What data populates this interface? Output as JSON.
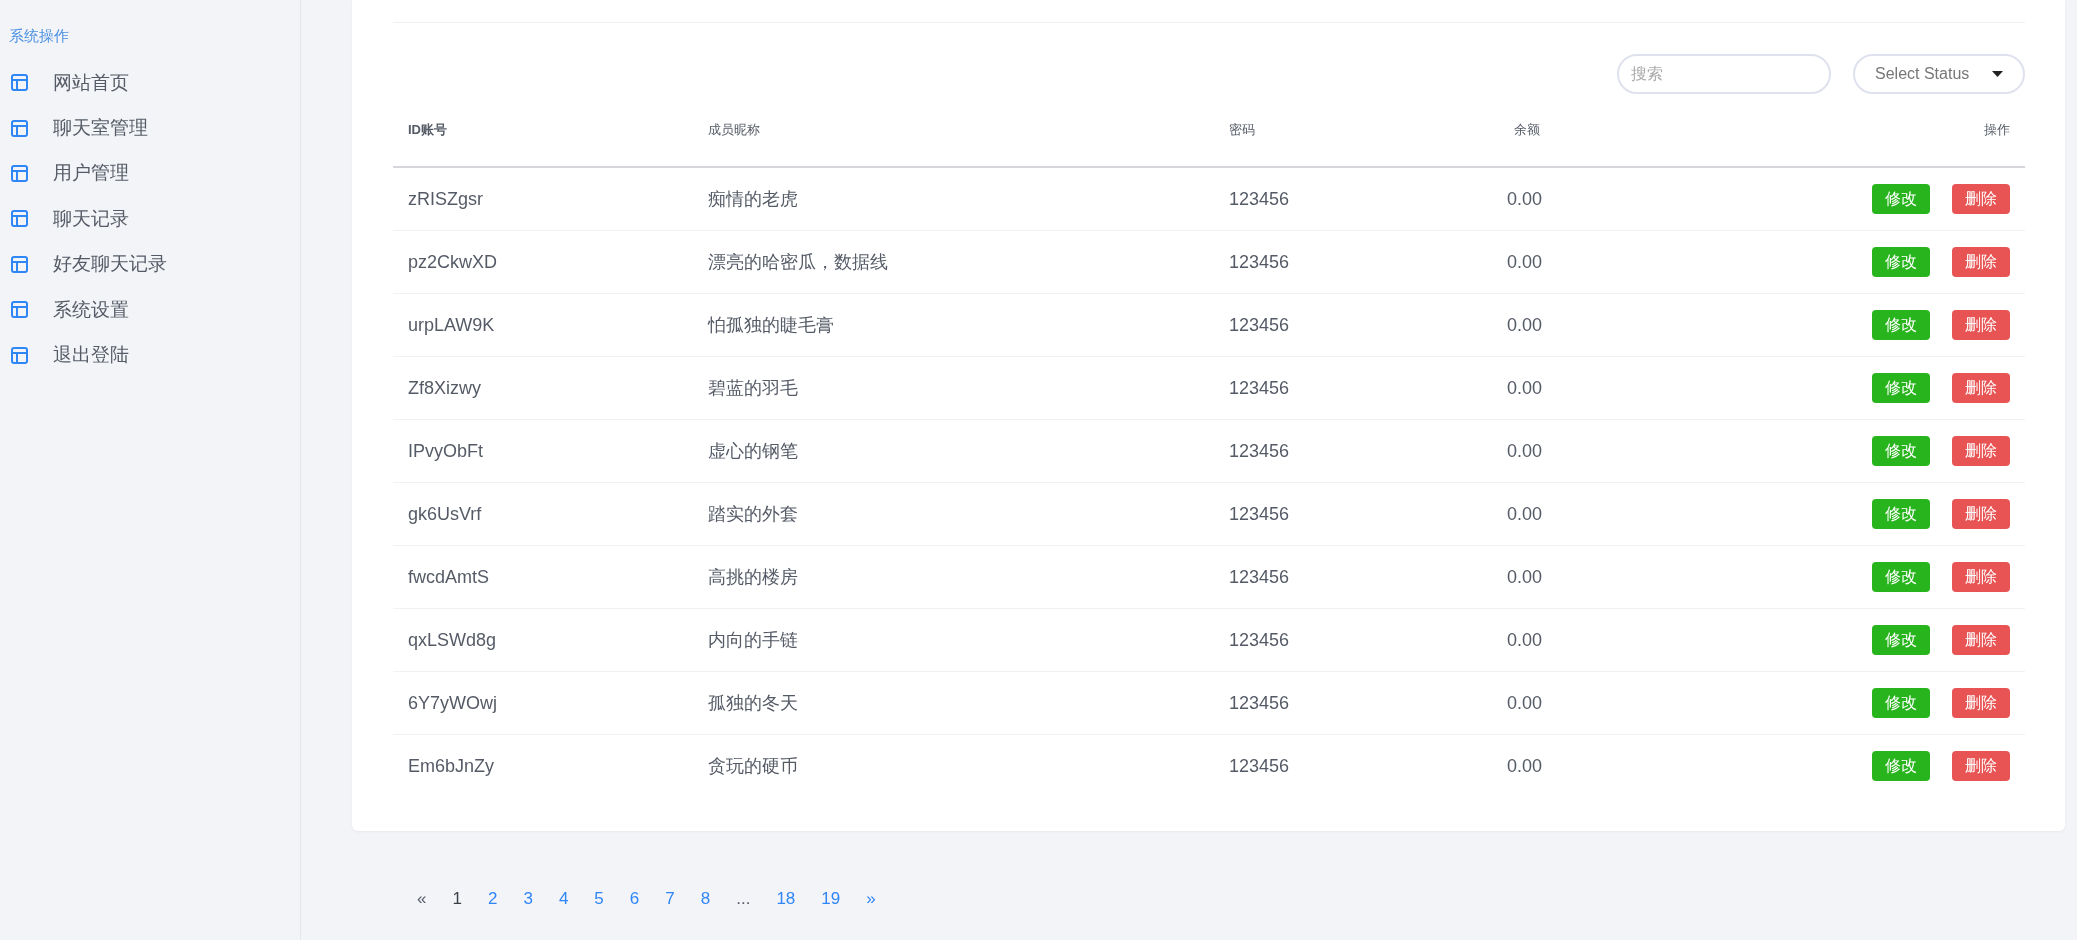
{
  "sidebar": {
    "title": "系统操作",
    "items": [
      {
        "label": "网站首页"
      },
      {
        "label": "聊天室管理"
      },
      {
        "label": "用户管理"
      },
      {
        "label": "聊天记录"
      },
      {
        "label": "好友聊天记录"
      },
      {
        "label": "系统设置"
      },
      {
        "label": "退出登陆"
      }
    ]
  },
  "search": {
    "placeholder": "搜索"
  },
  "status_select": {
    "value": "Select Status"
  },
  "table": {
    "columns": [
      "ID账号",
      "成员昵称",
      "密码",
      "余额",
      "操作"
    ],
    "rows": [
      {
        "id": "zRISZgsr",
        "nickname": "痴情的老虎",
        "password": "123456",
        "balance": "0.00",
        "edit": "修改",
        "delete": "删除"
      },
      {
        "id": "pz2CkwXD",
        "nickname": "漂亮的哈密瓜，数据线",
        "password": "123456",
        "balance": "0.00",
        "edit": "修改",
        "delete": "删除"
      },
      {
        "id": "urpLAW9K",
        "nickname": "怕孤独的睫毛膏",
        "password": "123456",
        "balance": "0.00",
        "edit": "修改",
        "delete": "删除"
      },
      {
        "id": "Zf8Xizwy",
        "nickname": "碧蓝的羽毛",
        "password": "123456",
        "balance": "0.00",
        "edit": "修改",
        "delete": "删除"
      },
      {
        "id": "IPvyObFt",
        "nickname": "虚心的钢笔",
        "password": "123456",
        "balance": "0.00",
        "edit": "修改",
        "delete": "删除"
      },
      {
        "id": "gk6UsVrf",
        "nickname": "踏实的外套",
        "password": "123456",
        "balance": "0.00",
        "edit": "修改",
        "delete": "删除"
      },
      {
        "id": "fwcdAmtS",
        "nickname": "高挑的楼房",
        "password": "123456",
        "balance": "0.00",
        "edit": "修改",
        "delete": "删除"
      },
      {
        "id": "qxLSWd8g",
        "nickname": "内向的手链",
        "password": "123456",
        "balance": "0.00",
        "edit": "修改",
        "delete": "删除"
      },
      {
        "id": "6Y7yWOwj",
        "nickname": "孤独的冬天",
        "password": "123456",
        "balance": "0.00",
        "edit": "修改",
        "delete": "删除"
      },
      {
        "id": "Em6bJnZy",
        "nickname": "贪玩的硬币",
        "password": "123456",
        "balance": "0.00",
        "edit": "修改",
        "delete": "删除"
      }
    ]
  },
  "pagination": [
    {
      "label": "«",
      "kind": "prev",
      "disabled": true
    },
    {
      "label": "1",
      "kind": "page",
      "selected": true
    },
    {
      "label": "2",
      "kind": "page",
      "selected": false
    },
    {
      "label": "3",
      "kind": "page",
      "selected": false
    },
    {
      "label": "4",
      "kind": "page",
      "selected": false
    },
    {
      "label": "5",
      "kind": "page",
      "selected": false
    },
    {
      "label": "6",
      "kind": "page",
      "selected": false
    },
    {
      "label": "7",
      "kind": "page",
      "selected": false
    },
    {
      "label": "8",
      "kind": "page",
      "selected": false
    },
    {
      "label": "...",
      "kind": "ellipsis"
    },
    {
      "label": "18",
      "kind": "page",
      "selected": false
    },
    {
      "label": "19",
      "kind": "page",
      "selected": false
    },
    {
      "label": "»",
      "kind": "next",
      "disabled": false
    }
  ]
}
